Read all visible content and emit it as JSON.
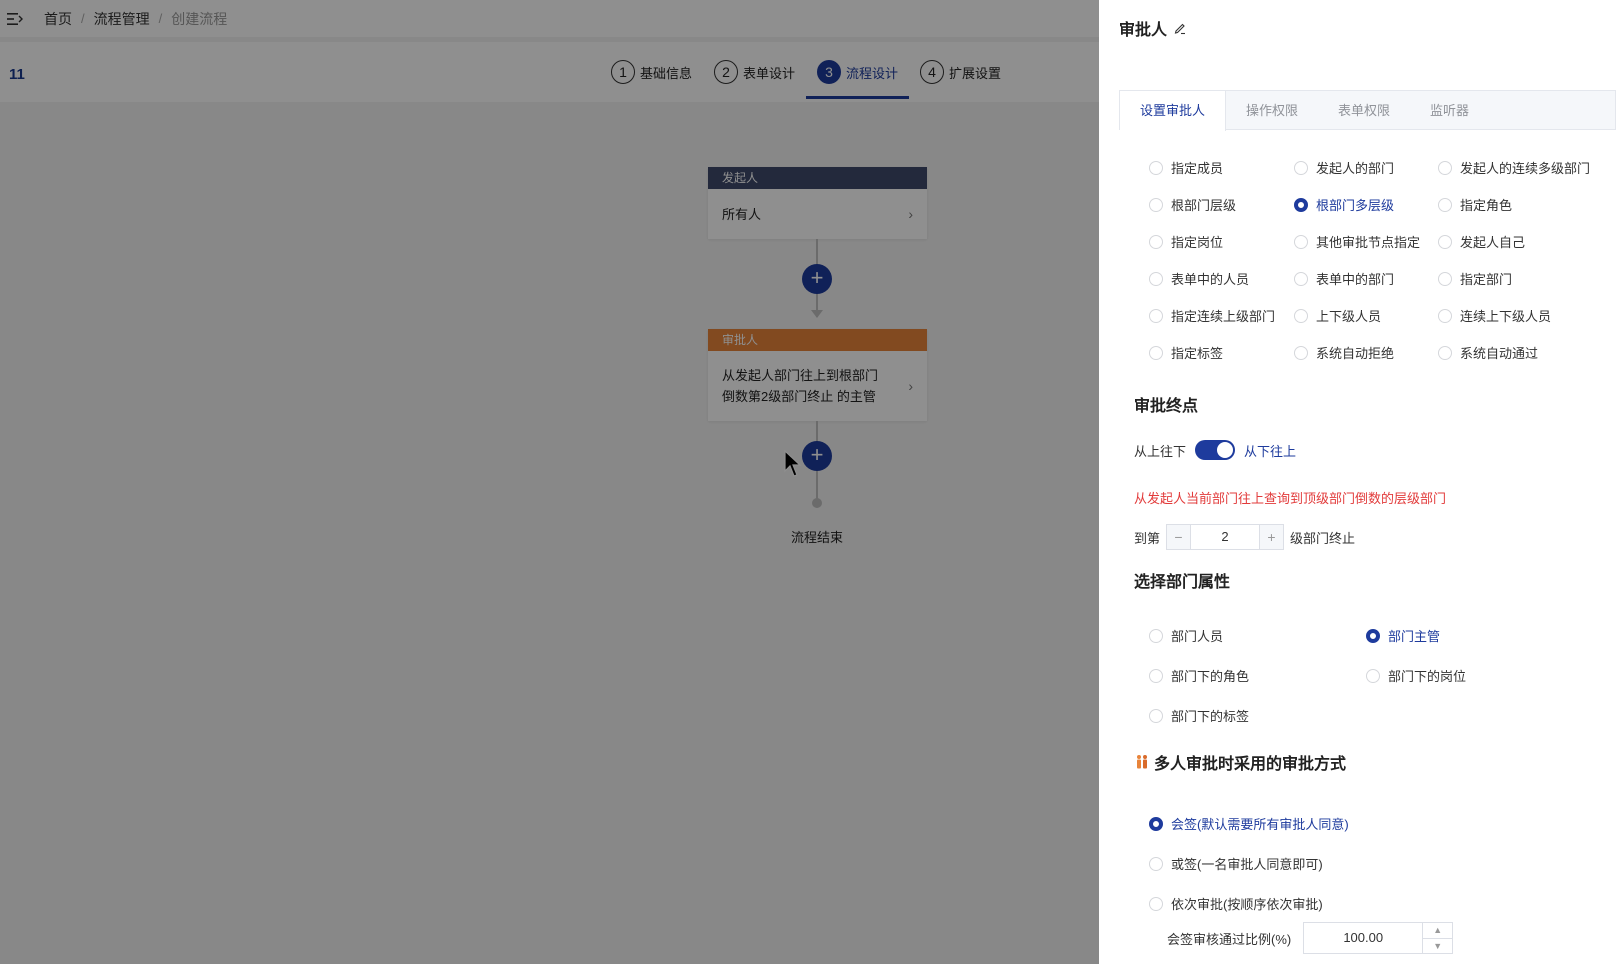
{
  "breadcrumb": {
    "home": "首页",
    "mid": "流程管理",
    "current": "创建流程",
    "separator": "/"
  },
  "process_name": "11",
  "steps": [
    {
      "num": "1",
      "label": "基础信息"
    },
    {
      "num": "2",
      "label": "表单设计"
    },
    {
      "num": "3",
      "label": "流程设计"
    },
    {
      "num": "4",
      "label": "扩展设置"
    }
  ],
  "flow": {
    "starter": {
      "header": "发起人",
      "body": "所有人",
      "color": "#3f4a6b"
    },
    "approver": {
      "header": "审批人",
      "body_line1": "从发起人部门往上到根部门",
      "body_line2": "倒数第2级部门终止 的主管",
      "color": "#e8843a"
    },
    "add_glyph": "+",
    "end_label": "流程结束"
  },
  "drawer": {
    "title": "审批人",
    "tabs": [
      "设置审批人",
      "操作权限",
      "表单权限",
      "监听器"
    ],
    "approver_types": [
      "指定成员",
      "发起人的部门",
      "发起人的连续多级部门",
      "根部门层级",
      "根部门多层级",
      "指定角色",
      "指定岗位",
      "其他审批节点指定",
      "发起人自己",
      "表单中的人员",
      "表单中的部门",
      "指定部门",
      "指定连续上级部门",
      "上下级人员",
      "连续上下级人员",
      "指定标签",
      "系统自动拒绝",
      "系统自动通过"
    ],
    "approver_type_selected": "根部门多层级",
    "endpoint": {
      "title": "审批终点",
      "left_label": "从上往下",
      "right_label": "从下往上",
      "toggle_on": true,
      "warning": "从发起人当前部门往上查询到顶级部门倒数的层级部门",
      "prefix": "到第",
      "value": "2",
      "suffix": "级部门终止",
      "minus": "−",
      "plus": "+"
    },
    "dept_attr": {
      "title": "选择部门属性",
      "options": [
        "部门人员",
        "部门主管",
        "部门下的角色",
        "部门下的岗位",
        "部门下的标签"
      ],
      "selected": "部门主管"
    },
    "multi": {
      "title": "多人审批时采用的审批方式",
      "options": [
        "会签(默认需要所有审批人同意)",
        "或签(一名审批人同意即可)",
        "依次审批(按顺序依次审批)"
      ],
      "selected": "会签(默认需要所有审批人同意)",
      "ratio_label": "会签审核通过比例(%)",
      "ratio_value": "100.00",
      "up": "▲",
      "down": "▼"
    }
  },
  "colors": {
    "primary": "#1e3b9d",
    "warning": "#e23b3b"
  }
}
